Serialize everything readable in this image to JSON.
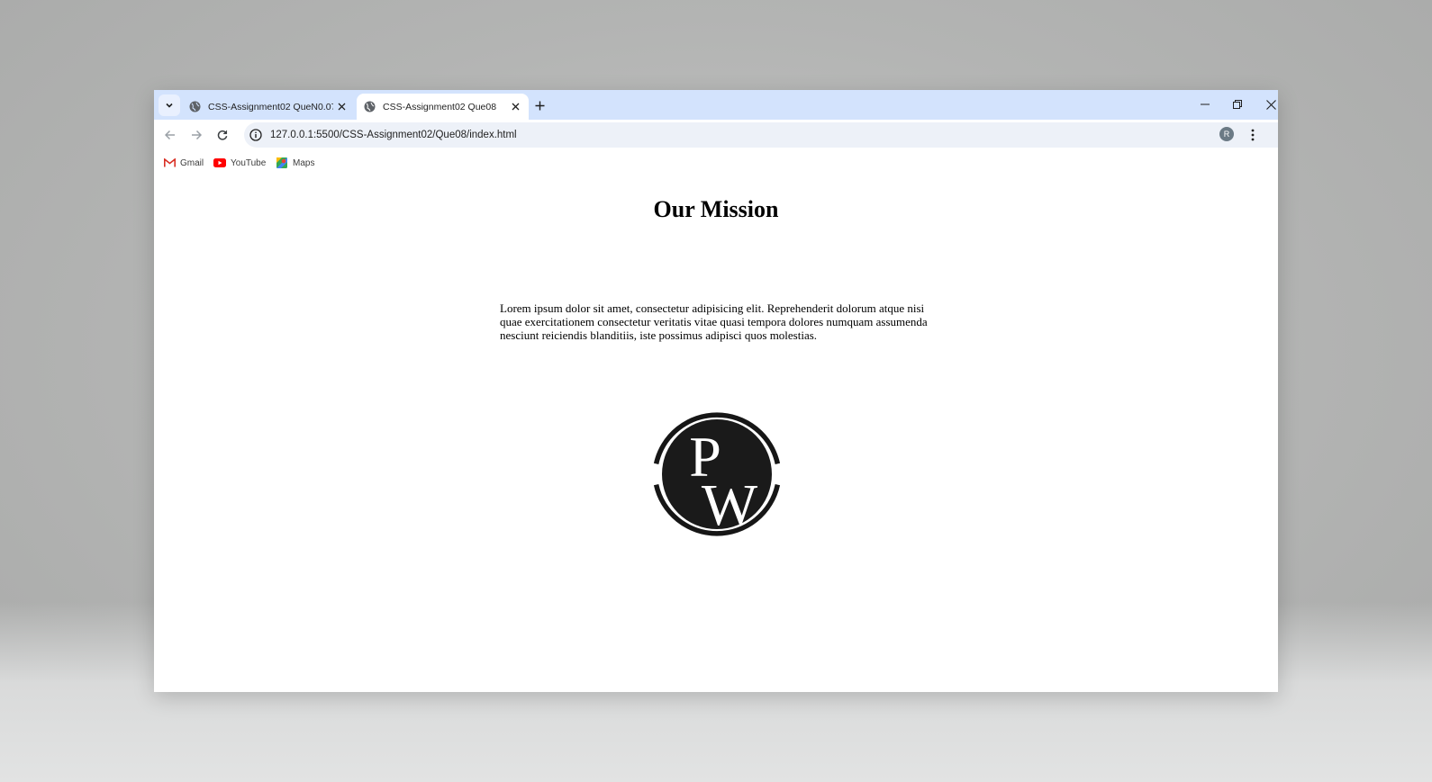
{
  "browser": {
    "tabs": [
      {
        "title": "CSS-Assignment02 QueN0.07",
        "active": false
      },
      {
        "title": "CSS-Assignment02 Que08",
        "active": true
      }
    ],
    "url": "127.0.0.1:5500/CSS-Assignment02/Que08/index.html",
    "profile_initial": "R",
    "bookmarks": [
      {
        "label": "Gmail",
        "icon": "gmail-icon"
      },
      {
        "label": "YouTube",
        "icon": "youtube-icon"
      },
      {
        "label": "Maps",
        "icon": "maps-icon"
      }
    ],
    "colors": {
      "tabstrip": "#d3e3fd",
      "omnibox": "#edf1f8"
    }
  },
  "page": {
    "heading": "Our Mission",
    "paragraph": "Lorem ipsum dolor sit amet, consectetur adipisicing elit. Reprehenderit dolorum atque nisi quae exercitationem consectetur veritatis vitae quasi tempora dolores numquam assumenda nesciunt reiciendis blanditiis, iste possimus adipisci quos molestias.",
    "logo": {
      "letters": "PW",
      "icon": "pw-logo"
    }
  }
}
